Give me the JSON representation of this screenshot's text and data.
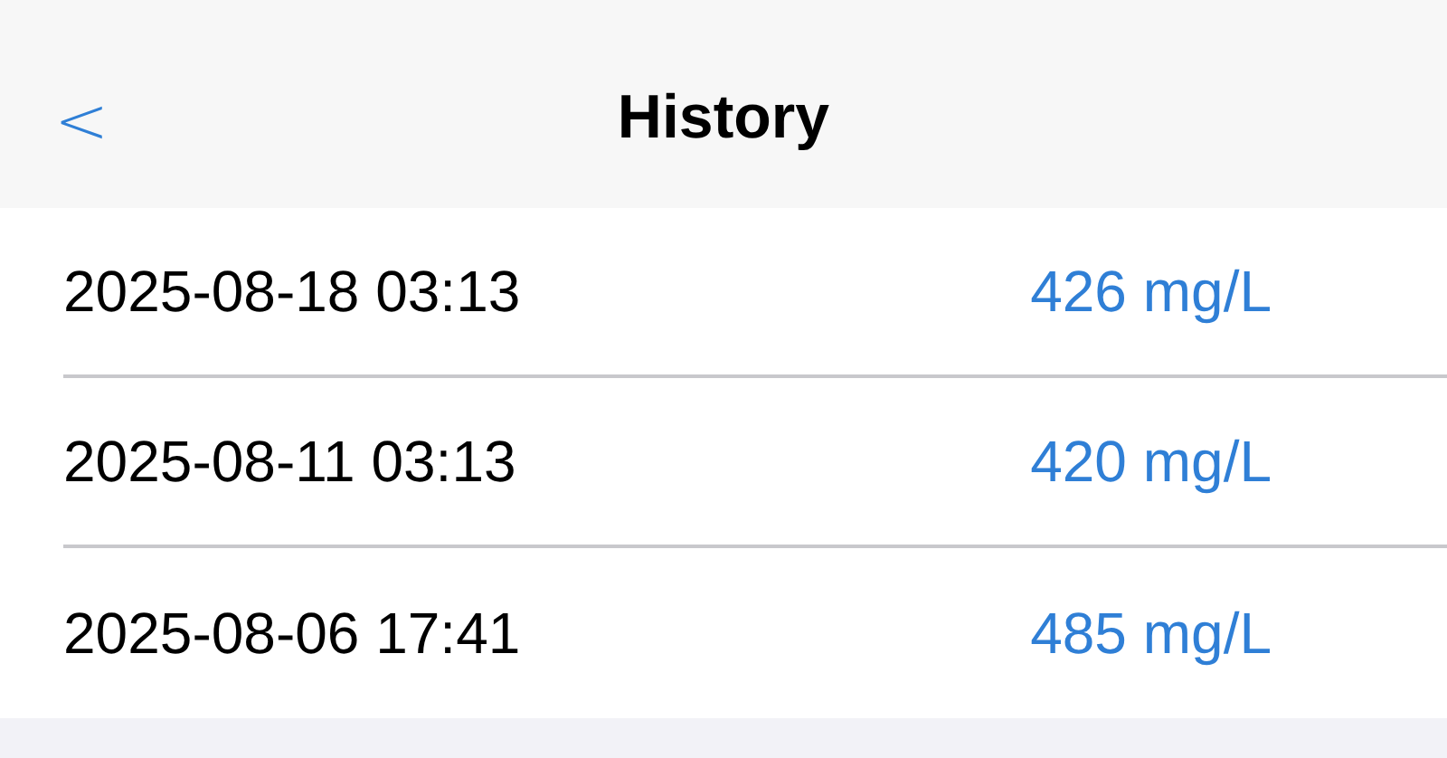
{
  "nav_bar": {
    "back": "<",
    "title": "History"
  },
  "rows": [
    {
      "date": "2025-08-18 03:13",
      "value": "426 mg/L"
    },
    {
      "date": "2025-08-11 03:13",
      "value": "420 mg/L"
    },
    {
      "date": "2025-08-06 17:41",
      "value": "485 mg/L"
    }
  ]
}
